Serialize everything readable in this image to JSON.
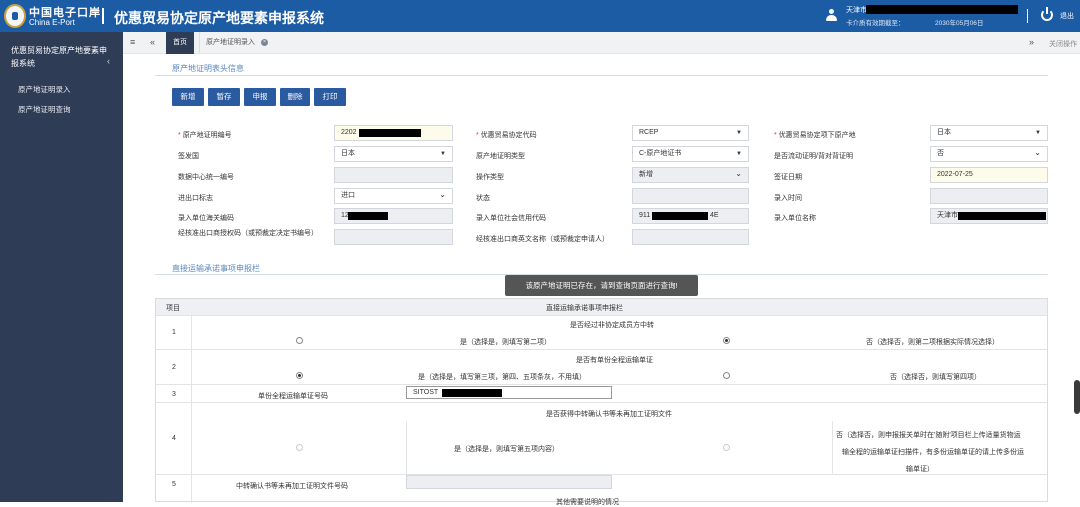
{
  "header": {
    "logo_cn": "中国电子口岸",
    "logo_en": "China E-Port",
    "title": "优惠贸易协定原产地要素申报系统",
    "user_name_prefix": "天津市",
    "cert_label": "卡介质有效期截至：",
    "cert_date": "2030年05月06日",
    "logout": "退出"
  },
  "sidebar": {
    "title": "优惠贸易协定原产地要素申报系统",
    "items": [
      "原产地证明录入",
      "原产地证明查询"
    ]
  },
  "tabs": {
    "home": "首页",
    "current": "原产地证明录入",
    "close_ops": "关闭操作"
  },
  "section1": {
    "title": "原产地证明表头信息"
  },
  "toolbar": {
    "buttons": [
      "新增",
      "暂存",
      "申报",
      "删除",
      "打印"
    ]
  },
  "form": {
    "cert_no_label": "原产地证明编号",
    "cert_no_value": "2202",
    "agreement_code_label": "优惠贸易协定代码",
    "agreement_code_value": "RCEP",
    "origin_place_label": "优惠贸易协定项下原产地",
    "origin_place_value": "日本",
    "issue_country_label": "签发国",
    "issue_country_value": "日本",
    "cert_type_label": "原产地证明类型",
    "cert_type_value": "C-原产地证书",
    "back_to_back_label": "是否流动证明/背对背证明",
    "back_to_back_value": "否",
    "data_center_no_label": "数据中心统一编号",
    "op_type_label": "操作类型",
    "op_type_value": "新增",
    "issue_date_label": "签证日期",
    "issue_date_value": "2022-07-25",
    "ie_flag_label": "进出口标志",
    "ie_flag_value": "进口",
    "status_label": "状态",
    "entry_time_label": "录入时间",
    "entry_customs_label": "录入单位海关编码",
    "entry_customs_value": "12",
    "entry_credit_label": "录入单位社会信用代码",
    "entry_credit_value_a": "911",
    "entry_credit_value_b": "4E",
    "entry_unit_label": "录入单位名称",
    "entry_unit_value": "天津市",
    "exporter_code_label": "经核准出口商授权码（或预裁定决定书编号）",
    "exporter_name_label": "经核准出口商英文名称（或预裁定申请人）"
  },
  "section2": {
    "title": "直接运输承诺事项申报栏"
  },
  "toast": "该原产地证明已存在，请到查询页面进行查询!",
  "table": {
    "col_item": "项目",
    "col_title": "直接运输承诺事项申报栏",
    "r1_no": "1",
    "r1_question": "是否经过非协定成员方中转",
    "r1_yes": "是（选择是，则填写第二项）",
    "r1_no_opt": "否（选择否，则第二项根据实际情况选择）",
    "r2_no": "2",
    "r2_question": "是否有单份全程运输单证",
    "r2_yes": "是（选择是，填写第三项，第四、五项条灰，不用填）",
    "r2_no_opt": "否（选择否，则填写第四项）",
    "r3_no": "3",
    "r3_label": "单份全程运输单证号码",
    "r3_value": "SITOST",
    "r4_no": "4",
    "r4_question": "是否获得中转确认书等未再加工证明文件",
    "r4_yes": "是（选择是，则填写第五项内容）",
    "r4_no_line1": "否（选择否，则申报报关单时在'随附'项目栏上传适量货物运",
    "r4_no_line2": "输全程的运输单证扫描件，有多份运输单证的请上传多份运",
    "r4_no_line3": "输单证）",
    "r5_no": "5",
    "r5_label": "中转确认书等未再加工证明文件号码",
    "r6_partial": "其他需要说明的情况"
  }
}
